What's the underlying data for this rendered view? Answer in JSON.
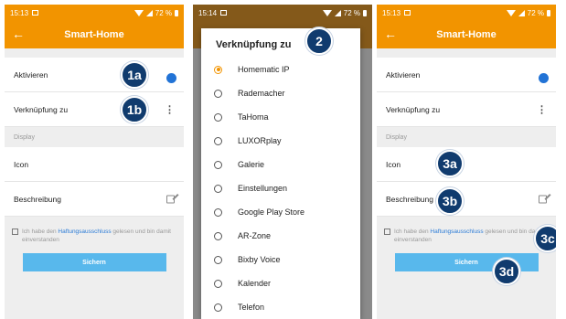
{
  "status": {
    "time_left": "15:13",
    "time_mid": "15:14",
    "time_right": "15:13",
    "battery": "72 %"
  },
  "appbar": {
    "title": "Smart-Home",
    "back_icon": "arrow-back-icon"
  },
  "settings": {
    "activate_label": "Aktivieren",
    "link_label": "Verknüpfung zu",
    "section_display": "Display",
    "icon_label": "Icon",
    "description_label": "Beschreibung",
    "consent_pre": "Ich habe den ",
    "consent_link": "Haftungsausschluss",
    "consent_post": " gelesen und bin damit einverstanden",
    "submit_label": "Sichern"
  },
  "dialog": {
    "title": "Verknüpfung zu",
    "selected": "Homematic IP",
    "options": [
      "Homematic IP",
      "Rademacher",
      "TaHoma",
      "LUXORplay",
      "Galerie",
      "Einstellungen",
      "Google Play Store",
      "AR-Zone",
      "Bixby Voice",
      "Kalender",
      "Telefon"
    ]
  },
  "badges": {
    "b1a": "1a",
    "b1b": "1b",
    "b2": "2",
    "b3a": "3a",
    "b3b": "3b",
    "b3c": "3c",
    "b3d": "3d"
  },
  "colors": {
    "accent": "#f29400",
    "badge": "#103b6e",
    "toggle": "#2273d6",
    "button": "#58b8ec",
    "link": "#2b7bd6"
  }
}
